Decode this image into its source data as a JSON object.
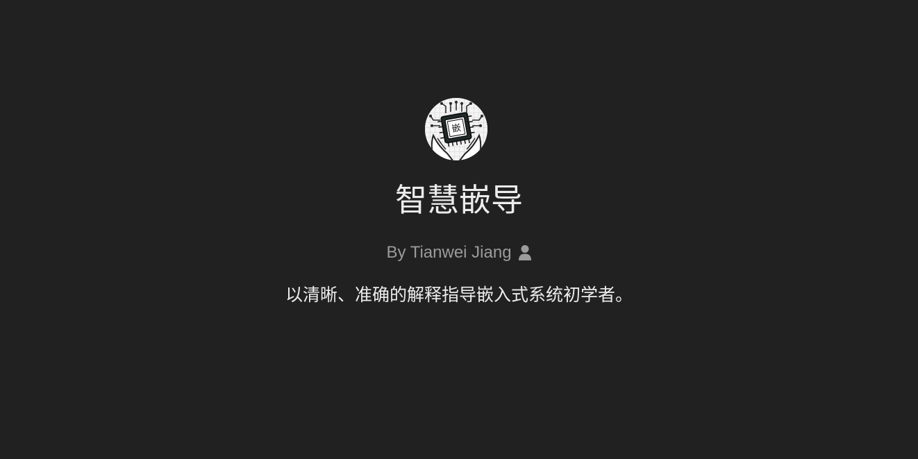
{
  "gpt": {
    "avatar_icon": "chip-in-hand-logo-icon",
    "avatar_char": "嵌",
    "title": "智慧嵌导",
    "author": "By Tianwei Jiang",
    "author_icon": "user-icon",
    "description": "以清晰、准确的解释指导嵌入式系统初学者。"
  },
  "colors": {
    "background": "#212121",
    "title": "#ececec",
    "byline": "#9b9b9b",
    "description": "#ececec"
  }
}
